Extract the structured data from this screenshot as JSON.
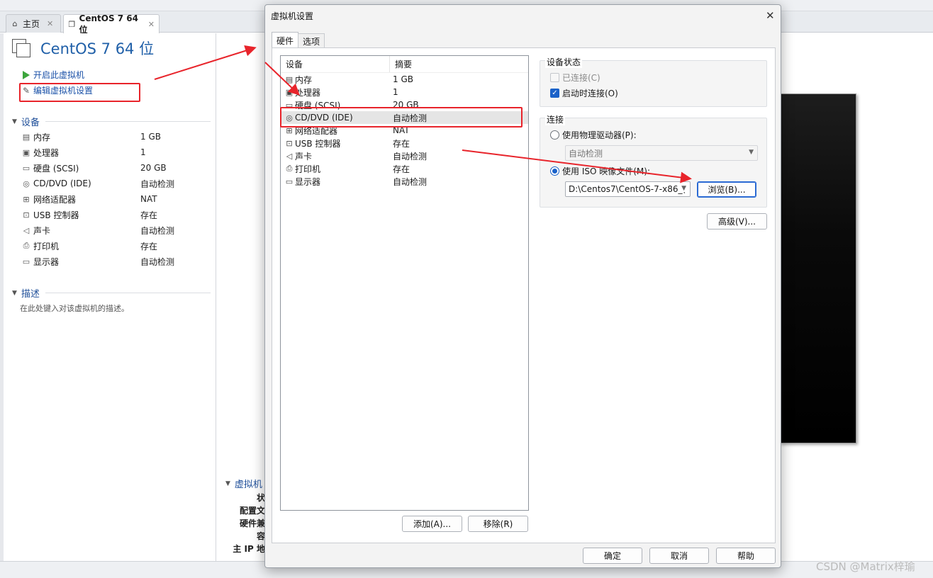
{
  "tabs": [
    {
      "label": "主页",
      "icon": "home-icon"
    },
    {
      "label": "CentOS 7 64 位",
      "icon": "vm-icon"
    }
  ],
  "vm": {
    "title": "CentOS 7 64 位",
    "actions": {
      "power_on": "开启此虚拟机",
      "edit_settings": "编辑虚拟机设置"
    },
    "devices_header": "设备",
    "devices": [
      {
        "name": "内存",
        "value": "1 GB",
        "icon": "memory-icon"
      },
      {
        "name": "处理器",
        "value": "1",
        "icon": "cpu-icon"
      },
      {
        "name": "硬盘 (SCSI)",
        "value": "20 GB",
        "icon": "harddisk-icon"
      },
      {
        "name": "CD/DVD (IDE)",
        "value": "自动检测",
        "icon": "cd-icon"
      },
      {
        "name": "网络适配器",
        "value": "NAT",
        "icon": "network-icon"
      },
      {
        "name": "USB 控制器",
        "value": "存在",
        "icon": "usb-icon"
      },
      {
        "name": "声卡",
        "value": "自动检测",
        "icon": "speaker-icon"
      },
      {
        "name": "打印机",
        "value": "存在",
        "icon": "printer-icon"
      },
      {
        "name": "显示器",
        "value": "自动检测",
        "icon": "monitor-icon"
      }
    ],
    "desc_header": "描述",
    "desc_placeholder": "在此处键入对该虚拟机的描述。",
    "details_header": "虚拟机",
    "details_labels": [
      "状",
      "配置文",
      "硬件兼容",
      "主 IP 地"
    ]
  },
  "dialog": {
    "title": "虚拟机设置",
    "close_glyph": "✕",
    "tabs": [
      "硬件",
      "选项"
    ],
    "list_headers": {
      "device": "设备",
      "summary": "摘要"
    },
    "hardware": [
      {
        "name": "内存",
        "summary": "1 GB",
        "icon": "memory-icon"
      },
      {
        "name": "处理器",
        "summary": "1",
        "icon": "cpu-icon"
      },
      {
        "name": "硬盘 (SCSI)",
        "summary": "20 GB",
        "icon": "harddisk-icon"
      },
      {
        "name": "CD/DVD (IDE)",
        "summary": "自动检测",
        "icon": "cd-icon",
        "selected": true
      },
      {
        "name": "网络适配器",
        "summary": "NAT",
        "icon": "network-icon"
      },
      {
        "name": "USB 控制器",
        "summary": "存在",
        "icon": "usb-icon"
      },
      {
        "name": "声卡",
        "summary": "自动检测",
        "icon": "speaker-icon"
      },
      {
        "name": "打印机",
        "summary": "存在",
        "icon": "printer-icon"
      },
      {
        "name": "显示器",
        "summary": "自动检测",
        "icon": "monitor-icon"
      }
    ],
    "add_button": "添加(A)...",
    "remove_button": "移除(R)",
    "device_status": {
      "label": "设备状态",
      "connected": {
        "label": "已连接(C)",
        "checked": false,
        "disabled": true
      },
      "connect_at_power_on": {
        "label": "启动时连接(O)",
        "checked": true
      }
    },
    "connection": {
      "label": "连接",
      "physical_drive": {
        "label": "使用物理驱动器(P):",
        "selected": false
      },
      "physical_drive_value": "自动检测",
      "iso_image": {
        "label": "使用 ISO 映像文件(M):",
        "selected": true
      },
      "iso_path": "D:\\Centos7\\CentOS-7-x86_(",
      "browse_button": "浏览(B)..."
    },
    "advanced_button": "高级(V)...",
    "ok_button": "确定",
    "cancel_button": "取消",
    "help_button": "帮助"
  },
  "watermark": "CSDN @Matrix梓瑜",
  "colors": {
    "annotation": "#e8242b",
    "accent": "#1a62c9",
    "title_blue": "#1f5fa8"
  }
}
